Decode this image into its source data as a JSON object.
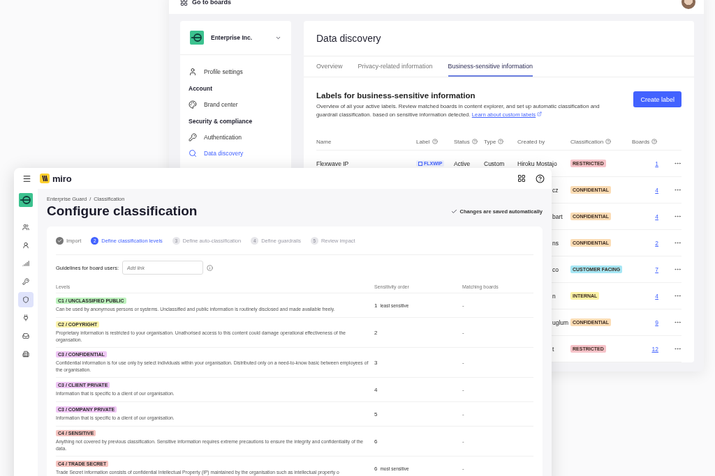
{
  "back_window": {
    "top_bar": {
      "link": "Go to boards"
    },
    "sidebar": {
      "org": "Enterprise Inc.",
      "items": [
        {
          "kind": "item",
          "label": "Profile settings",
          "selected": false
        },
        {
          "kind": "heading",
          "label": "Account"
        },
        {
          "kind": "item",
          "label": "Brand center",
          "selected": false
        },
        {
          "kind": "heading",
          "label": "Security & compliance"
        },
        {
          "kind": "item",
          "label": "Authentication",
          "selected": false
        },
        {
          "kind": "item",
          "label": "Data discovery",
          "selected": true
        }
      ]
    },
    "main": {
      "title": "Data discovery",
      "tabs": [
        {
          "label": "Overview",
          "selected": false
        },
        {
          "label": "Privacy-related information",
          "selected": false
        },
        {
          "label": "Business-sensitive information",
          "selected": true
        }
      ],
      "section_title": "Labels for business-sensitive information",
      "description": "Overview of all your active labels. Review matched boards in content explorer, and set up automatic classification and guardrail classification. based on sensitive information detected.",
      "learn_link": "Learn about custom labels",
      "create_button": "Create label",
      "table": {
        "columns": [
          {
            "label": "Name",
            "help": false
          },
          {
            "label": "Label",
            "help": true
          },
          {
            "label": "Status",
            "help": true
          },
          {
            "label": "Type",
            "help": true
          },
          {
            "label": "Created by",
            "help": false
          },
          {
            "label": "Classification",
            "help": true
          },
          {
            "label": "Boards",
            "help": true
          }
        ],
        "rows": [
          {
            "kind": "full",
            "name": "Flexwave IP",
            "label": "FLXWIP",
            "status": "Active",
            "type": "Custom",
            "created_by": "Hiroku Mostajo",
            "classification": "RESTRICTED",
            "color": "#f6c3c9",
            "boards": "1"
          },
          {
            "kind": "covered",
            "created_by": "cz",
            "classification": "CONFIDENTIAL",
            "color": "#fbdcb4",
            "boards": "4"
          },
          {
            "kind": "covered",
            "created_by": "bart",
            "classification": "CONFIDENTIAL",
            "color": "#fbdcb4",
            "boards": "4"
          },
          {
            "kind": "covered",
            "created_by": "ns",
            "classification": "CONFIDENTIAL",
            "color": "#fbdcb4",
            "boards": "2"
          },
          {
            "kind": "covered",
            "created_by": "co",
            "classification": "CUSTOMER FACING",
            "color": "#a6e6f4",
            "boards": "7"
          },
          {
            "kind": "covered",
            "created_by": "n",
            "classification": "INTERNAL",
            "color": "#fbf2a6",
            "boards": "4"
          },
          {
            "kind": "covered",
            "created_by": "uglum",
            "classification": "CONFIDENTIAL",
            "color": "#fbdcb4",
            "boards": "9"
          },
          {
            "kind": "covered",
            "created_by": "t",
            "classification": "RESTRICTED",
            "color": "#f6c3c9",
            "boards": "12"
          }
        ]
      }
    }
  },
  "front_window": {
    "logo": "miro",
    "rail": [
      {
        "selected": false
      },
      {
        "selected": false
      },
      {
        "selected": false
      },
      {
        "selected": false
      },
      {
        "selected": true
      },
      {
        "selected": false
      },
      {
        "selected": false
      },
      {
        "selected": false
      }
    ],
    "breadcrumb": {
      "items": [
        "Enterprise Guard",
        "Classification"
      ],
      "separator": "/"
    },
    "title": "Configure classification",
    "save_status": "Changes are saved automatically",
    "steps": [
      {
        "label": "Import",
        "completed": true,
        "selected": false
      },
      {
        "number": "2",
        "label": "Define classification levels",
        "completed": false,
        "selected": true
      },
      {
        "number": "3",
        "label": "Define auto-classification",
        "completed": false,
        "selected": false
      },
      {
        "number": "4",
        "label": "Define guardrails",
        "completed": false,
        "selected": false
      },
      {
        "number": "5",
        "label": "Review impact",
        "completed": false,
        "selected": false
      }
    ],
    "guidelines": {
      "label": "Guidelines for board users:",
      "placeholder": "Add link"
    },
    "levels": {
      "columns": [
        "Levels",
        "Sensitivity order",
        "Matching boards"
      ],
      "rows": [
        {
          "tag": "C1 / UNCLASSIFIED PUBLIC",
          "color": "#bdf2bd",
          "description": "Can be used by anonymous persons or systems. Unclassified and public information is routinely disclosed and made available freely.",
          "order": "1",
          "order_note": "least sensitive",
          "matching": "-"
        },
        {
          "tag": "C2 / COPYRIGHT",
          "color": "#fbf3ab",
          "description": "Proprietary information is restricted to your organisation. Unathorised access to this content could damage operational effectiveness of the organsation.",
          "order": "2",
          "matching": "-"
        },
        {
          "tag": "C3 / CONFIDENTIAL",
          "color": "#efc6f5",
          "description": "Confidential information is for use only by select individuals within your organisation. Distributed only on a need-to-know basic between employees of the organisation.",
          "order": "3",
          "matching": "-"
        },
        {
          "tag": "C3 / CLIENT PRIVATE",
          "color": "#efc6f5",
          "description": "Information that is specific to a client of our organisation.",
          "order": "4",
          "matching": "-"
        },
        {
          "tag": "C3 / COMPANY PRIVATE",
          "color": "#efc6f5",
          "description": "Information that is specific to a client of our organisation.",
          "order": "5",
          "matching": "-"
        },
        {
          "tag": "C4 / SENSITIVE",
          "color": "#f6c4c0",
          "description": "Anything not covered by previous classification. Sensitive information requires extreme precautions to ensure the integrity and confidentiality of the data.",
          "order": "6",
          "matching": "-"
        },
        {
          "tag": "C4 / TRADE SECRET",
          "color": "#f6c4c0",
          "description": "Trade Secret information consists of confidential Intellectual Property (IP) maintained by the organisation such as intellectual property o",
          "order": "6",
          "order_note": "most sensitive",
          "matching": "-"
        }
      ]
    }
  }
}
